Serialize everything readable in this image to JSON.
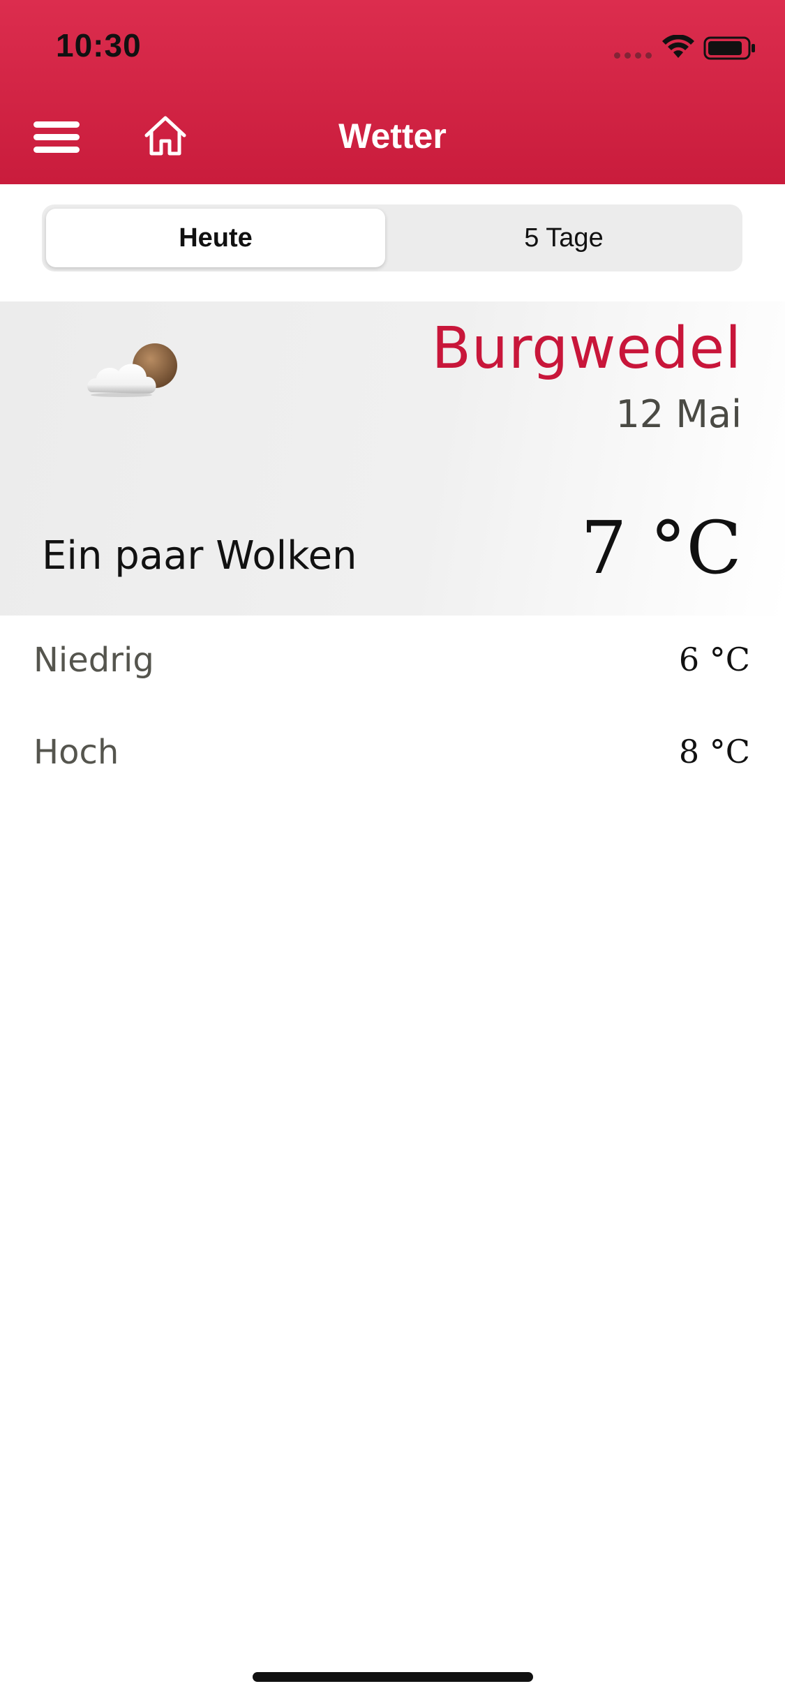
{
  "status_bar": {
    "time": "10:30"
  },
  "header": {
    "title": "Wetter",
    "menu_icon": "hamburger-menu-icon",
    "home_icon": "home-icon",
    "background_color": "#d4244a"
  },
  "tabs": [
    {
      "label": "Heute",
      "selected": true
    },
    {
      "label": "5 Tage",
      "selected": false
    }
  ],
  "weather": {
    "city": "Burgwedel",
    "date": "12 Mai",
    "condition": "Ein paar Wolken",
    "temperature": "7 °C",
    "icon": "cloud-night-icon",
    "accent_color": "#c8163a"
  },
  "details": [
    {
      "label": "Niedrig",
      "value": "6 °C"
    },
    {
      "label": "Hoch",
      "value": "8 °C"
    }
  ]
}
